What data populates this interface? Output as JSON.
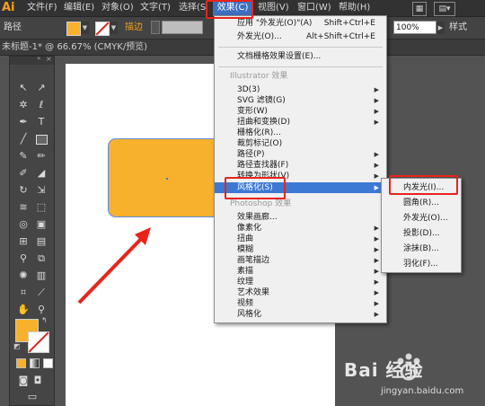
{
  "app": {
    "logo": "Ai"
  },
  "menubar": {
    "items": [
      {
        "label": "文件(F)"
      },
      {
        "label": "编辑(E)"
      },
      {
        "label": "对象(O)"
      },
      {
        "label": "文字(T)"
      },
      {
        "label": "选择(S"
      },
      {
        "label": "效果(C)"
      },
      {
        "label": "视图(V)"
      },
      {
        "label": "窗口(W)"
      },
      {
        "label": "帮助(H)"
      }
    ]
  },
  "controlbar": {
    "object_type": "路径",
    "stroke_label": "描边",
    "opacity_value": "100%",
    "style_label": "样式"
  },
  "document": {
    "tab_title": "未标题-1* @ 66.67% (CMYK/预览)"
  },
  "effect_menu": {
    "items": [
      {
        "label": "应用 \"外发光(O)\"(A)",
        "shortcut": "Shift+Ctrl+E"
      },
      {
        "label": "外发光(O)...",
        "shortcut": "Alt+Shift+Ctrl+E"
      },
      {
        "label": "文档栅格效果设置(E)..."
      },
      {
        "label": "3D(3)"
      },
      {
        "label": "SVG 滤镜(G)"
      },
      {
        "label": "变形(W)"
      },
      {
        "label": "扭曲和变换(D)"
      },
      {
        "label": "栅格化(R)..."
      },
      {
        "label": "裁剪标记(O)"
      },
      {
        "label": "路径(P)"
      },
      {
        "label": "路径查找器(F)"
      },
      {
        "label": "转换为形状(V)"
      },
      {
        "label": "风格化(S)"
      },
      {
        "label": "效果画廊..."
      },
      {
        "label": "像素化"
      },
      {
        "label": "扭曲"
      },
      {
        "label": "模糊"
      },
      {
        "label": "画笔描边"
      },
      {
        "label": "素描"
      },
      {
        "label": "纹理"
      },
      {
        "label": "艺术效果"
      },
      {
        "label": "视频"
      },
      {
        "label": "风格化"
      }
    ],
    "section_illustrator": "Illustrator 效果",
    "section_photoshop": "Photoshop 效果"
  },
  "stylize_submenu": {
    "items": [
      {
        "label": "内发光(I)..."
      },
      {
        "label": "圆角(R)..."
      },
      {
        "label": "外发光(O)..."
      },
      {
        "label": "投影(D)..."
      },
      {
        "label": "涂抹(B)..."
      },
      {
        "label": "羽化(F)..."
      }
    ]
  },
  "colors": {
    "shape_fill": "#f7b12d",
    "highlight": "#3c79d4",
    "annotation": "#e8241c"
  },
  "watermark": {
    "brand": "Bai 经验",
    "url": "jingyan.baidu.com"
  }
}
